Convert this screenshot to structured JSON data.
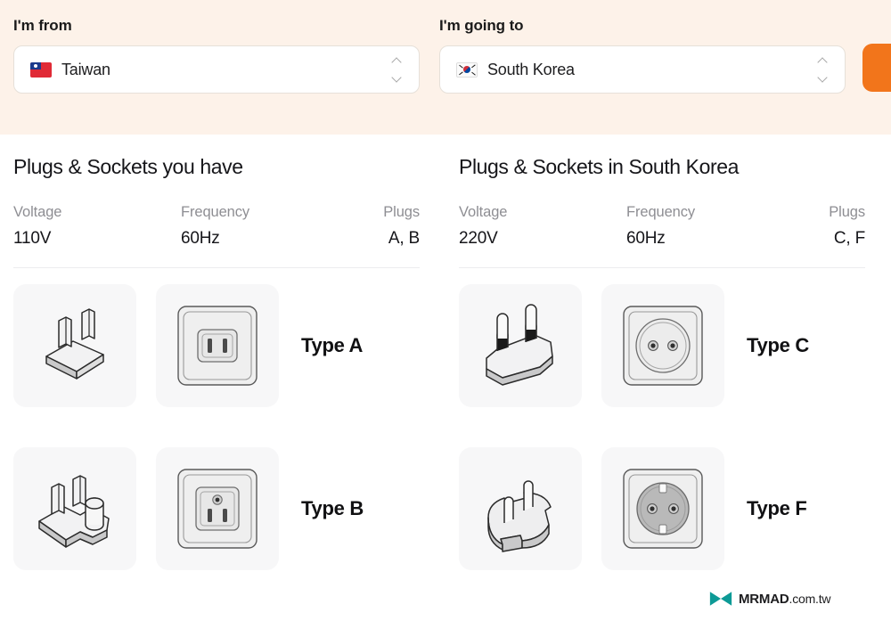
{
  "header": {
    "from": {
      "label": "I'm from",
      "value": "Taiwan",
      "flag_name": "taiwan-flag",
      "stepper_name": "from-country-stepper"
    },
    "to": {
      "label": "I'm going to",
      "value": "South Korea",
      "flag_name": "south-korea-flag",
      "stepper_name": "to-country-stepper"
    },
    "action_button": {
      "label": "",
      "color": "#f2751b"
    },
    "band_color": "#fdf2e9"
  },
  "columns": [
    {
      "title": "Plugs & Sockets you have",
      "specs": [
        {
          "label": "Voltage",
          "value": "110V"
        },
        {
          "label": "Frequency",
          "value": "60Hz"
        },
        {
          "label": "Plugs",
          "value": "A, B"
        }
      ],
      "plugs": [
        {
          "type_label": "Type A",
          "plug_icon": "type-a-plug-icon",
          "socket_icon": "type-a-socket-icon"
        },
        {
          "type_label": "Type B",
          "plug_icon": "type-b-plug-icon",
          "socket_icon": "type-b-socket-icon"
        }
      ]
    },
    {
      "title": "Plugs & Sockets in South Korea",
      "specs": [
        {
          "label": "Voltage",
          "value": "220V"
        },
        {
          "label": "Frequency",
          "value": "60Hz"
        },
        {
          "label": "Plugs",
          "value": "C, F"
        }
      ],
      "plugs": [
        {
          "type_label": "Type C",
          "plug_icon": "type-c-plug-icon",
          "socket_icon": "type-c-socket-icon"
        },
        {
          "type_label": "Type F",
          "plug_icon": "type-f-plug-icon",
          "socket_icon": "type-f-socket-icon"
        }
      ]
    }
  ],
  "watermark": {
    "brand": "MRMAD",
    "tld": ".com.tw",
    "logo_color": "#0d9a96"
  }
}
